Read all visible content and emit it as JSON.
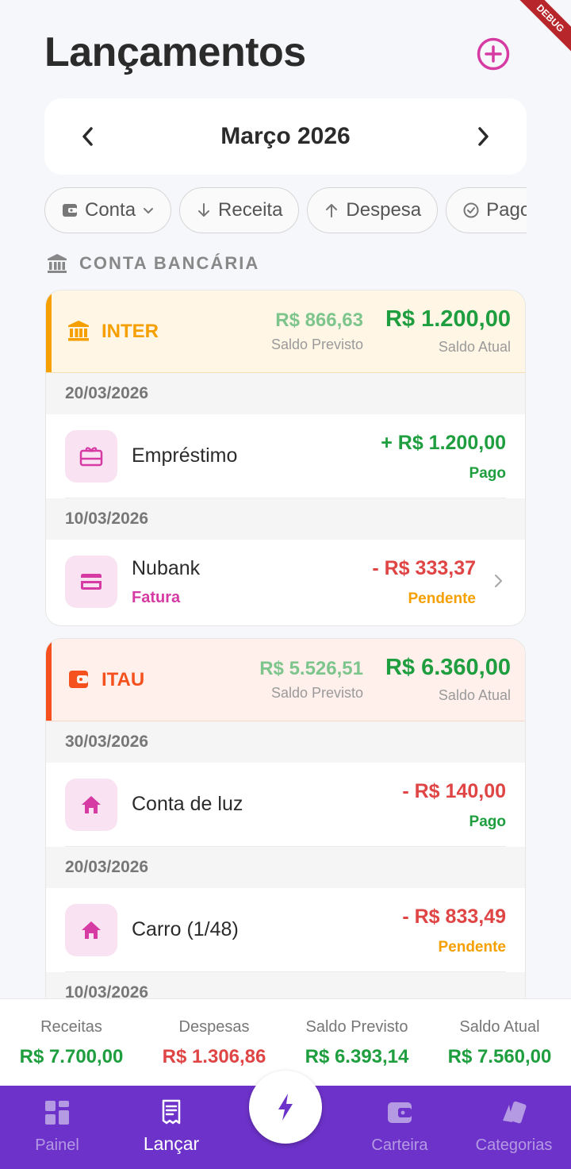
{
  "header": {
    "title": "Lançamentos",
    "debug_banner": "DEBUG"
  },
  "month_selector": {
    "label": "Março 2026"
  },
  "filters": [
    {
      "label": "Conta",
      "icon": "wallet-icon"
    },
    {
      "label": "Receita",
      "icon": "arrow-down-icon"
    },
    {
      "label": "Despesa",
      "icon": "arrow-up-icon"
    },
    {
      "label": "Pago",
      "icon": "check-circle-icon"
    }
  ],
  "section": {
    "label": "CONTA BANCÁRIA"
  },
  "accounts": [
    {
      "name": "INTER",
      "color": "#f5a000",
      "saldo_previsto": "R$ 866,63",
      "saldo_previsto_label": "Saldo Previsto",
      "saldo_atual": "R$ 1.200,00",
      "saldo_atual_label": "Saldo Atual",
      "groups": [
        {
          "date": "20/03/2026",
          "transactions": [
            {
              "name": "Empréstimo",
              "amount": "+ R$ 1.200,00",
              "status": "Pago",
              "icon": "gift-card-icon"
            }
          ]
        },
        {
          "date": "10/03/2026",
          "transactions": [
            {
              "name": "Nubank",
              "subtitle": "Fatura",
              "amount": "- R$ 333,37",
              "status": "Pendente",
              "icon": "credit-card-icon"
            }
          ]
        }
      ]
    },
    {
      "name": "ITAU",
      "color": "#f4511e",
      "saldo_previsto": "R$ 5.526,51",
      "saldo_previsto_label": "Saldo Previsto",
      "saldo_atual": "R$ 6.360,00",
      "saldo_atual_label": "Saldo Atual",
      "groups": [
        {
          "date": "30/03/2026",
          "transactions": [
            {
              "name": "Conta de luz",
              "amount": "- R$ 140,00",
              "status": "Pago",
              "icon": "home-icon"
            }
          ]
        },
        {
          "date": "20/03/2026",
          "transactions": [
            {
              "name": "Carro (1/48)",
              "amount": "- R$ 833,49",
              "status": "Pendente",
              "icon": "home-icon"
            }
          ]
        },
        {
          "date": "10/03/2026",
          "transactions": []
        }
      ]
    }
  ],
  "summary": [
    {
      "label": "Receitas",
      "value": "R$ 7.700,00"
    },
    {
      "label": "Despesas",
      "value": "R$ 1.306,86"
    },
    {
      "label": "Saldo Previsto",
      "value": "R$ 6.393,14"
    },
    {
      "label": "Saldo Atual",
      "value": "R$ 7.560,00"
    }
  ],
  "nav": [
    {
      "label": "Painel",
      "icon": "dashboard-icon"
    },
    {
      "label": "Lançar",
      "icon": "receipt-icon"
    },
    {
      "label": "Carteira",
      "icon": "wallet-icon"
    },
    {
      "label": "Categorias",
      "icon": "cards-icon"
    }
  ],
  "colors": {
    "primary": "#6d32c9",
    "accent": "#d63aa3",
    "income": "#1e9e3e",
    "expense": "#e04545",
    "pending": "#f5a000"
  }
}
